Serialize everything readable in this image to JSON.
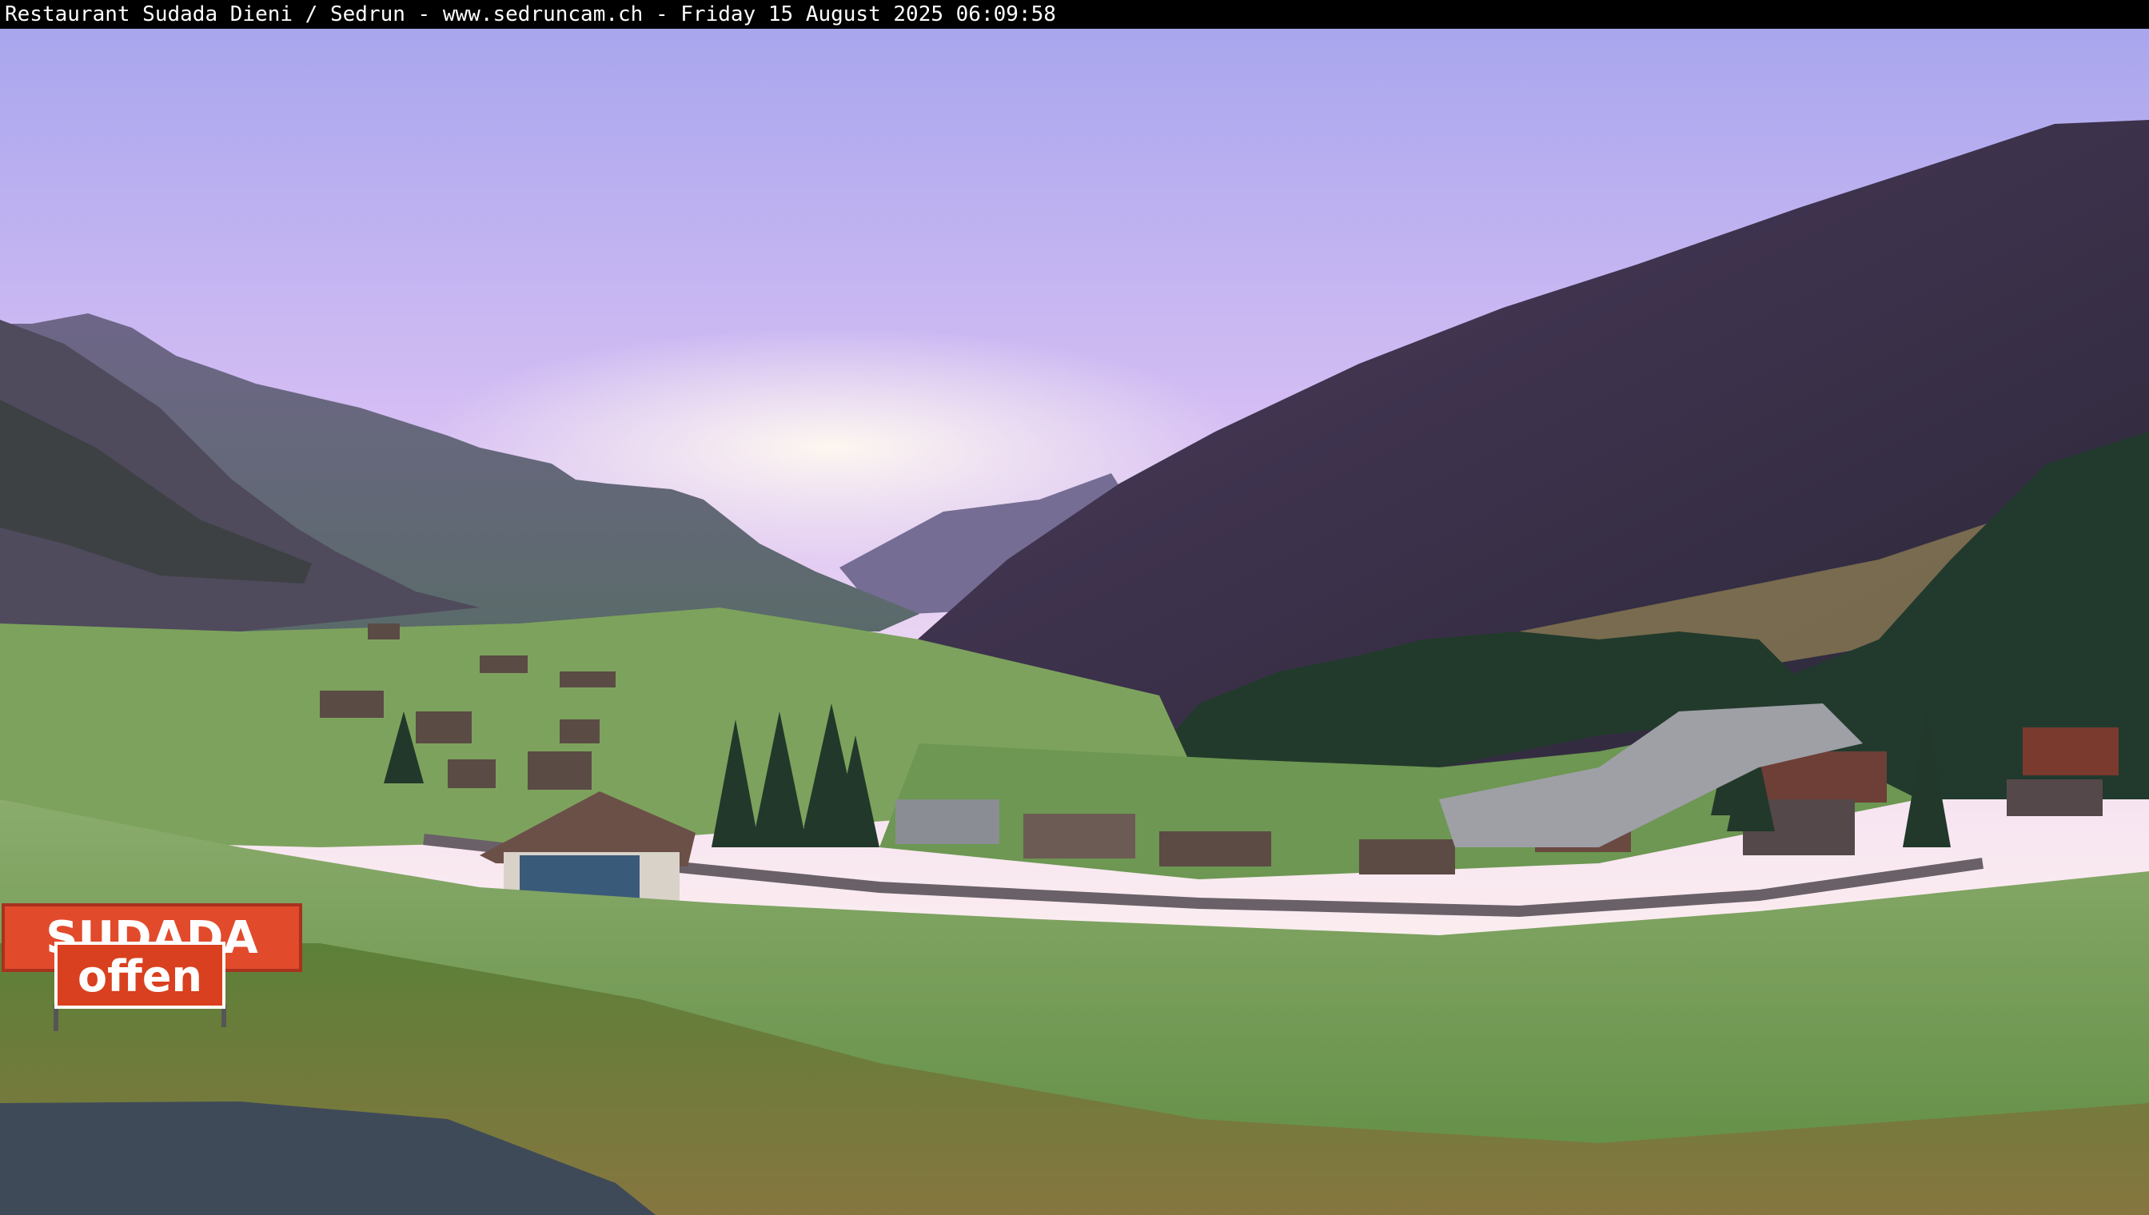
{
  "caption": {
    "text": "Restaurant Sudada Dieni / Sedrun - www.sedruncam.ch - Friday 15 August 2025 06:09:58"
  },
  "signs": {
    "top": "SUDADA",
    "bottom": "offen"
  },
  "colors": {
    "sky_top": "#a9a6ee",
    "sky_glow": "#fff3ee",
    "mountain_right": "#3d2f4e",
    "meadow": "#7ca061",
    "sign_red": "#e24a2c"
  }
}
